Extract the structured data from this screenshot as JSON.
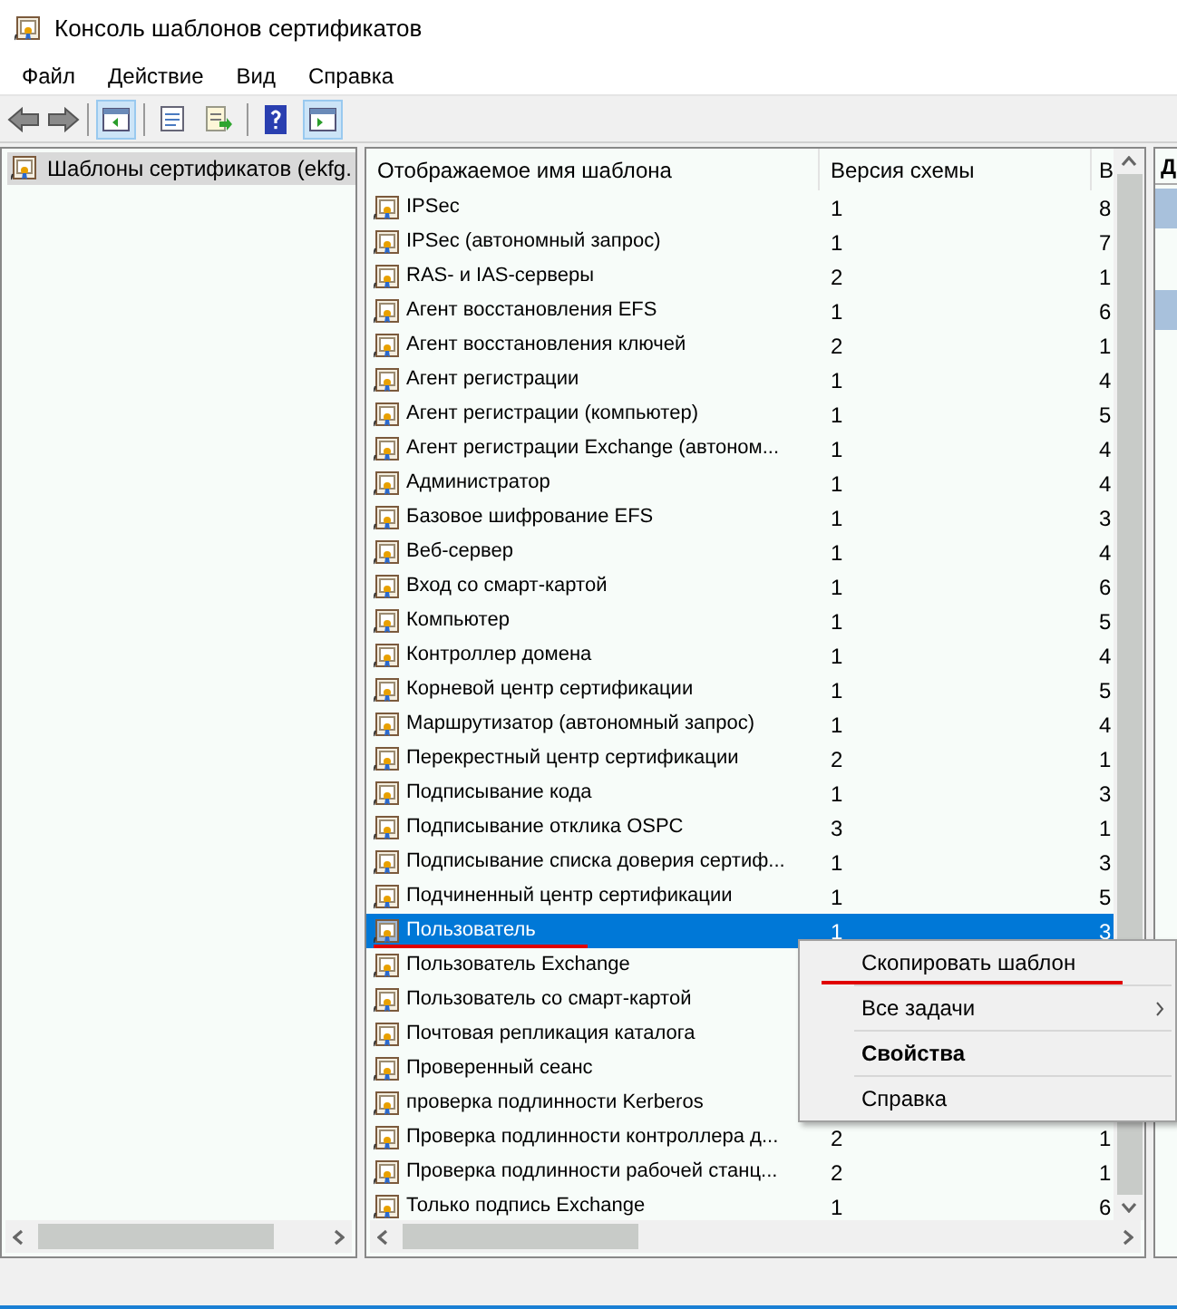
{
  "window": {
    "title": "Консоль шаблонов сертификатов"
  },
  "menu_bar": [
    "Файл",
    "Действие",
    "Вид",
    "Справка"
  ],
  "tree": {
    "items": [
      {
        "label": "Шаблоны сертификатов (ekfg.",
        "selected": true
      }
    ]
  },
  "table": {
    "columns": [
      "Отображаемое имя шаблона",
      "Версия схемы",
      "В"
    ],
    "rows": [
      {
        "name": "IPSec",
        "version": "1",
        "column_3": "8",
        "selected": false
      },
      {
        "name": "IPSec (автономный запрос)",
        "version": "1",
        "column_3": "7",
        "selected": false
      },
      {
        "name": "RAS- и IAS-серверы",
        "version": "2",
        "column_3": "1",
        "selected": false
      },
      {
        "name": "Агент восстановления EFS",
        "version": "1",
        "column_3": "6",
        "selected": false
      },
      {
        "name": "Агент восстановления ключей",
        "version": "2",
        "column_3": "1",
        "selected": false
      },
      {
        "name": "Агент регистрации",
        "version": "1",
        "column_3": "4",
        "selected": false
      },
      {
        "name": "Агент регистрации (компьютер)",
        "version": "1",
        "column_3": "5",
        "selected": false
      },
      {
        "name": "Агент регистрации Exchange (автоном...",
        "version": "1",
        "column_3": "4",
        "selected": false
      },
      {
        "name": "Администратор",
        "version": "1",
        "column_3": "4",
        "selected": false
      },
      {
        "name": "Базовое шифрование EFS",
        "version": "1",
        "column_3": "3",
        "selected": false
      },
      {
        "name": "Веб-сервер",
        "version": "1",
        "column_3": "4",
        "selected": false
      },
      {
        "name": "Вход со смарт-картой",
        "version": "1",
        "column_3": "6",
        "selected": false
      },
      {
        "name": "Компьютер",
        "version": "1",
        "column_3": "5",
        "selected": false
      },
      {
        "name": "Контроллер домена",
        "version": "1",
        "column_3": "4",
        "selected": false
      },
      {
        "name": "Корневой центр сертификации",
        "version": "1",
        "column_3": "5",
        "selected": false
      },
      {
        "name": "Маршрутизатор (автономный запрос)",
        "version": "1",
        "column_3": "4",
        "selected": false
      },
      {
        "name": "Перекрестный центр сертификации",
        "version": "2",
        "column_3": "1",
        "selected": false
      },
      {
        "name": "Подписывание кода",
        "version": "1",
        "column_3": "3",
        "selected": false
      },
      {
        "name": "Подписывание отклика OSPC",
        "version": "3",
        "column_3": "1",
        "selected": false
      },
      {
        "name": "Подписывание списка доверия сертиф...",
        "version": "1",
        "column_3": "3",
        "selected": false
      },
      {
        "name": "Подчиненный центр сертификации",
        "version": "1",
        "column_3": "5",
        "selected": false
      },
      {
        "name": "Пользователь",
        "version": "1",
        "column_3": "3",
        "selected": true
      },
      {
        "name": "Пользователь Exchange",
        "selected": false
      },
      {
        "name": "Пользователь со смарт-картой",
        "selected": false
      },
      {
        "name": "Почтовая репликация каталога",
        "selected": false
      },
      {
        "name": "Проверенный сеанс",
        "selected": false
      },
      {
        "name": "проверка подлинности Kerberos",
        "selected": false
      },
      {
        "name": "Проверка подлинности контроллера д...",
        "version": "2",
        "column_3": "1",
        "selected": false
      },
      {
        "name": "Проверка подлинности рабочей станц...",
        "version": "2",
        "column_3": "1",
        "selected": false
      },
      {
        "name": "Только подпись Exchange",
        "version": "1",
        "column_3": "6",
        "selected": false
      }
    ]
  },
  "actions_pane": {
    "header": "Д"
  },
  "context_menu": [
    {
      "label": "Скопировать шаблон",
      "bold": false,
      "submenu": false,
      "underlined": true
    },
    {
      "label": "Все задачи",
      "bold": false,
      "submenu": true,
      "underlined": false
    },
    {
      "label": "Свойства",
      "bold": true,
      "submenu": false,
      "underlined": false
    },
    {
      "label": "Справка",
      "bold": false,
      "submenu": false,
      "underlined": false
    }
  ]
}
